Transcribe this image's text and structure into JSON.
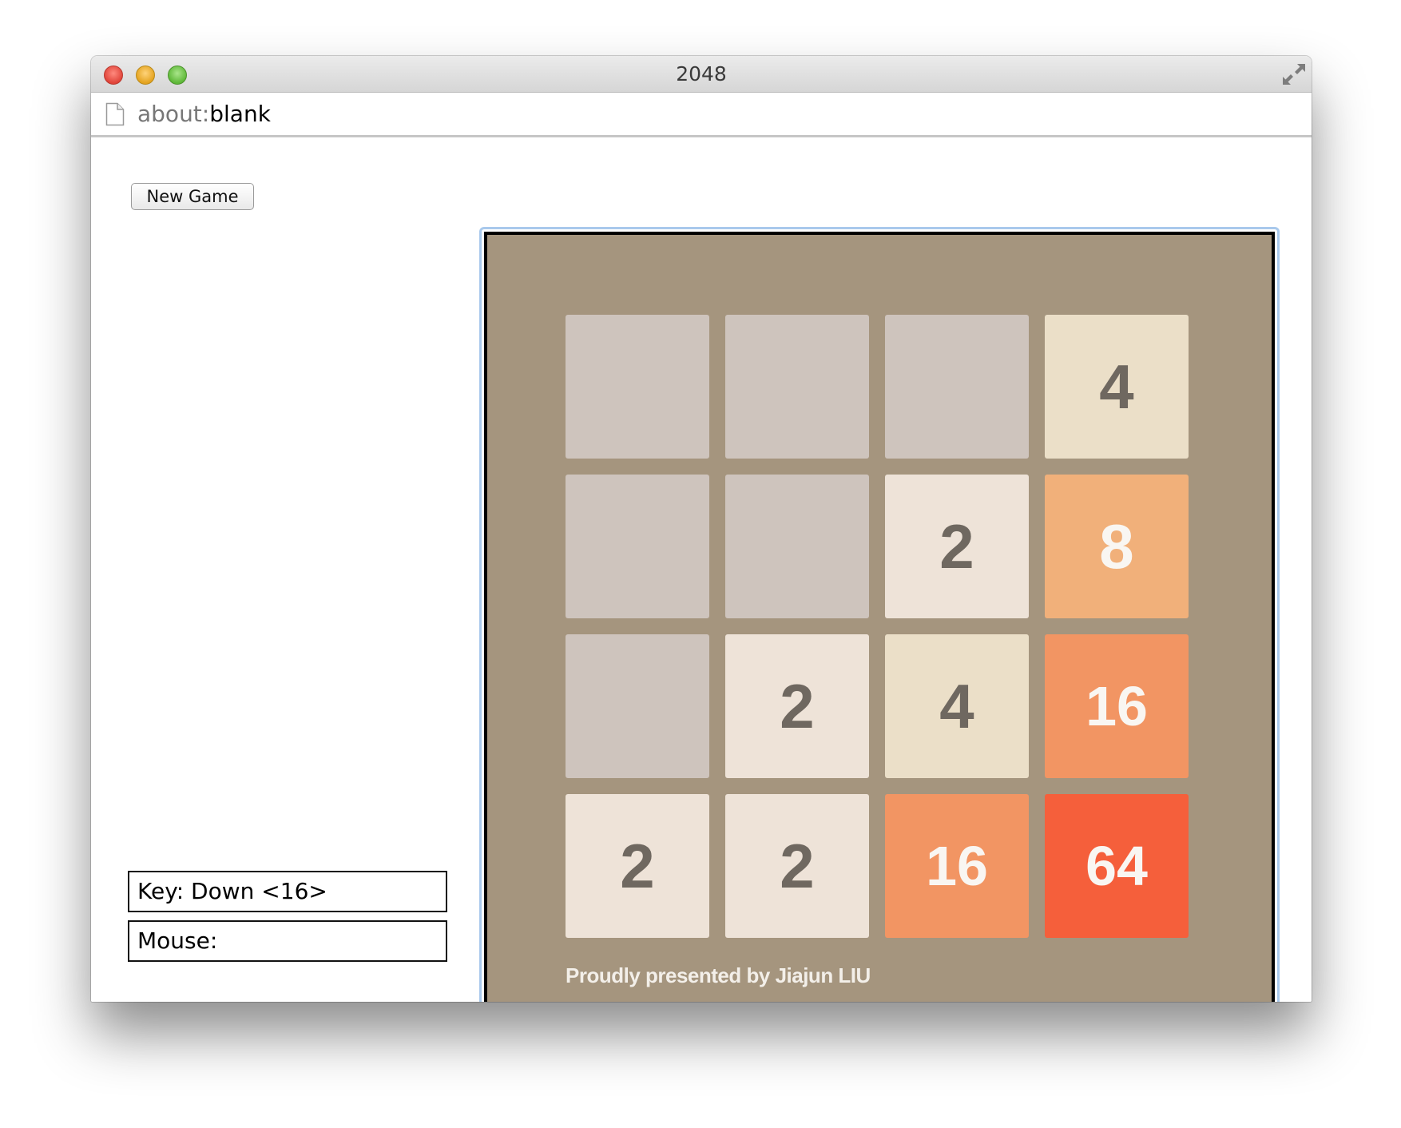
{
  "window": {
    "title": "2048"
  },
  "addressbar": {
    "url_scheme": "about:",
    "url_path": "blank"
  },
  "controls": {
    "new_game_label": "New Game"
  },
  "status": {
    "key_text": "Key: Down <16>",
    "mouse_text": "Mouse:"
  },
  "board": {
    "rows": 4,
    "cols": 4,
    "cells": [
      [
        null,
        null,
        null,
        4
      ],
      [
        null,
        null,
        2,
        8
      ],
      [
        null,
        2,
        4,
        16
      ],
      [
        2,
        2,
        16,
        64
      ]
    ],
    "credit": "Proudly presented by Jiajun LIU"
  },
  "colors": {
    "board_background": "#a5957e",
    "empty_tile": "#cec4bd",
    "tile_2": "#eee3d8",
    "tile_4": "#ebdfc8",
    "tile_8": "#f1b07a",
    "tile_16": "#f29563",
    "tile_64": "#f55f3b",
    "dark_text": "#6f6860",
    "light_text": "#f9f6f2",
    "focus_ring": "#a9c9ec"
  },
  "icons": {
    "close": "close-icon",
    "minimize": "minimize-icon",
    "zoom": "zoom-icon",
    "fullscreen": "fullscreen-icon",
    "page": "page-icon"
  }
}
